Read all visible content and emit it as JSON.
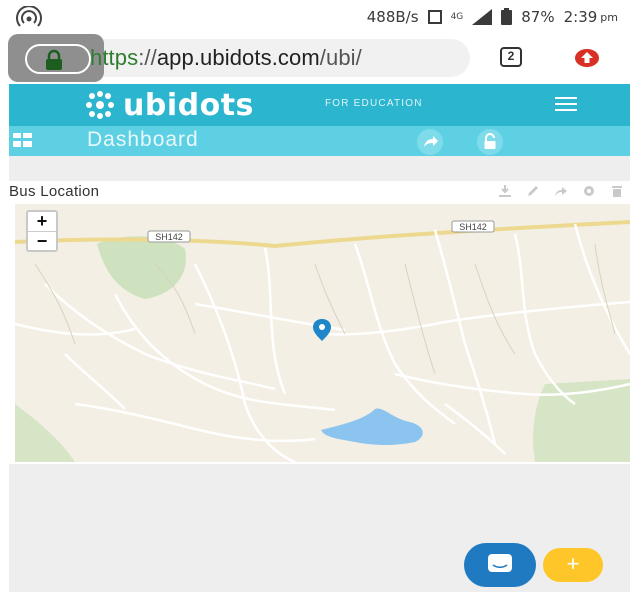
{
  "status_bar": {
    "speed": "488B/s",
    "network": "4G",
    "battery": "87%",
    "time": "2:39",
    "time_suffix": "pm"
  },
  "browser": {
    "url_scheme": "https",
    "url_sep": "://",
    "url_host": "app.ubidots.com",
    "url_path": "/ubi/",
    "tabs_count": "2"
  },
  "app": {
    "logo": "ubidots",
    "edition": "FOR EDUCATION",
    "brand_color": "#2bb5cf"
  },
  "dashboard": {
    "title": "Dashboard"
  },
  "widget": {
    "title": "Bus Location"
  },
  "map": {
    "road_label_1": "SH142",
    "road_label_2": "SH142",
    "zoom_in": "+",
    "zoom_out": "−"
  },
  "fab": {
    "add_label": "+"
  }
}
